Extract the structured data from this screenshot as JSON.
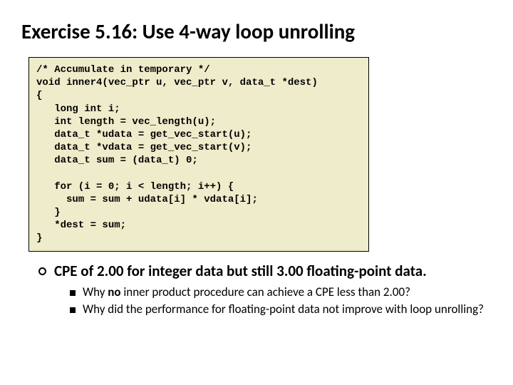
{
  "title": "Exercise 5.16: Use 4-way loop unrolling",
  "code": "/* Accumulate in temporary */\nvoid inner4(vec_ptr u, vec_ptr v, data_t *dest)\n{\n   long int i;\n   int length = vec_length(u);\n   data_t *udata = get_vec_start(u);\n   data_t *vdata = get_vec_start(v);\n   data_t sum = (data_t) 0;\n\n   for (i = 0; i < length; i++) {\n     sum = sum + udata[i] * vdata[i];\n   }\n   *dest = sum;\n}",
  "bullet": "CPE of 2.00 for integer data but still 3.00 floating-point data.",
  "sub1_a": "Why ",
  "sub1_b": "no",
  "sub1_c": " inner product procedure can achieve a CPE less than 2.00?",
  "sub2": "Why did the performance for floating-point data not improve with loop unrolling?"
}
